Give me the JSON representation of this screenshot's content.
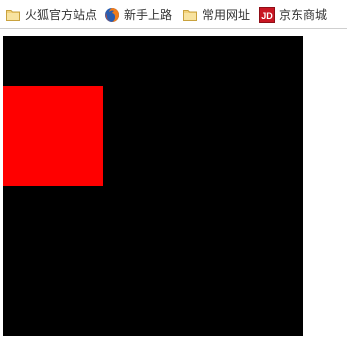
{
  "bookmarks": [
    {
      "label": "火狐官方站点",
      "icon": "folder-icon"
    },
    {
      "label": "新手上路",
      "icon": "firefox-icon"
    },
    {
      "label": "常用网址",
      "icon": "folder-icon"
    },
    {
      "label": "京东商城",
      "icon": "jd-icon"
    }
  ],
  "canvas": {
    "background": "#000000",
    "square_color": "#ff0000"
  }
}
